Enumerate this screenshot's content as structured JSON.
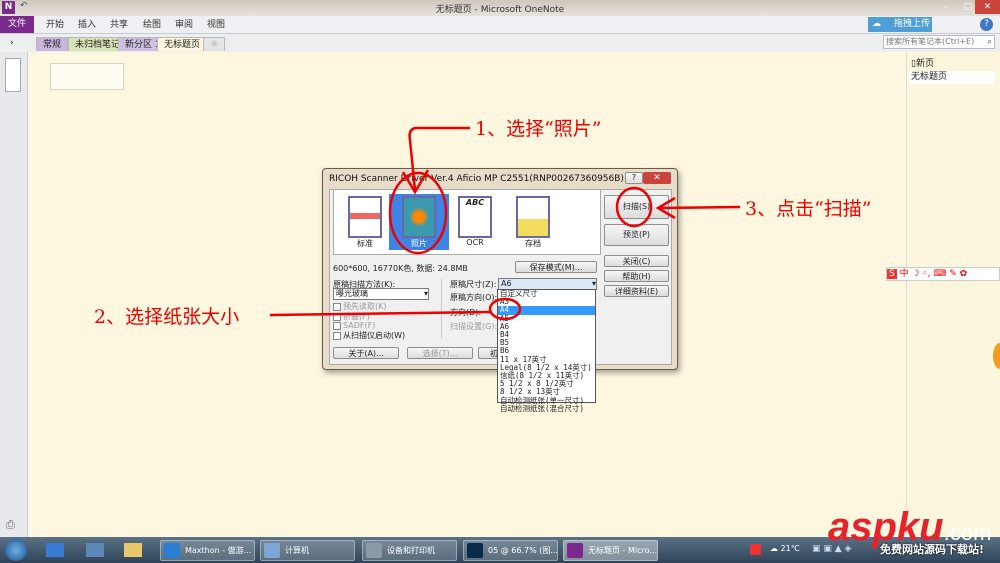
{
  "window": {
    "title": "无标题页 - Microsoft OneNote"
  },
  "ribbon": {
    "file": "文件",
    "tabs": [
      "开始",
      "插入",
      "共享",
      "绘图",
      "审阅",
      "视图"
    ],
    "upload": "拖拽上传"
  },
  "sections": {
    "tabs": [
      "常规",
      "未归档笔记",
      "新分区 1",
      "无标题页"
    ],
    "add": "☼"
  },
  "search": {
    "placeholder": "搜索所有笔记本(Ctrl+E)"
  },
  "pages": {
    "new_page": "新页",
    "items": [
      "无标题页"
    ]
  },
  "dialog": {
    "title": "RICOH Scanner Driver Ver.4 Aficio MP C2551(RNP00267360956B)",
    "modes": [
      "标准",
      "照片",
      "OCR",
      "存档"
    ],
    "selected_mode": "照片",
    "info": "600*600, 16770K色, 数据: 24.8MB",
    "save_mode": "保存模式(M)...",
    "scan_method_label": "原稿扫描方法(K):",
    "scan_method_value": "曝光玻璃",
    "checks": [
      "预先读取(K)",
      "折叠(F)",
      "SADF(F)",
      "从扫描仪启动(W)"
    ],
    "size_label": "原稿尺寸(Z):",
    "size_value": "A6",
    "orient_label": "原稿方向(O):",
    "dir_label": "方向(D):",
    "scan_settings": "扫描设置(G):",
    "buttons": {
      "scan": "扫描(S)",
      "preview": "预览(P)",
      "close": "关闭(C)",
      "help": "帮助(H)",
      "details": "详细资料(E)",
      "about": "关于(A)...",
      "select": "选择(T)...",
      "init": "初始"
    },
    "size_options": [
      "自定义尺寸",
      "A3",
      "A4",
      "A5",
      "A6",
      "B4",
      "B5",
      "B6",
      "11 x 17英寸",
      "Legal(8 1/2 x 14英寸)",
      "信纸(8 1/2 x 11英寸)",
      "5 1/2 x 8 1/2英寸",
      "8 1/2 x 13英寸",
      "自动检测纸张(单一尺寸)",
      "自动检测纸张(混合尺寸)"
    ],
    "highlighted_option": "A4"
  },
  "annotations": [
    "1、选择“照片”",
    "2、选择纸张大小",
    "3、点击“扫描”"
  ],
  "taskbar": {
    "items": [
      "Maxthon - 傲游...",
      "计算机",
      "设备和打印机",
      "05 @ 66.7% (图...",
      "无标题页 - Micro..."
    ],
    "temp": "21℃"
  },
  "watermark": {
    "logo": "aspku",
    "sub": ".com",
    "tagline": "免费网站源码下载站!"
  },
  "colors": {
    "accent": "#7a2a8c",
    "annotation": "#e00000",
    "highlight": "#3399ff"
  }
}
